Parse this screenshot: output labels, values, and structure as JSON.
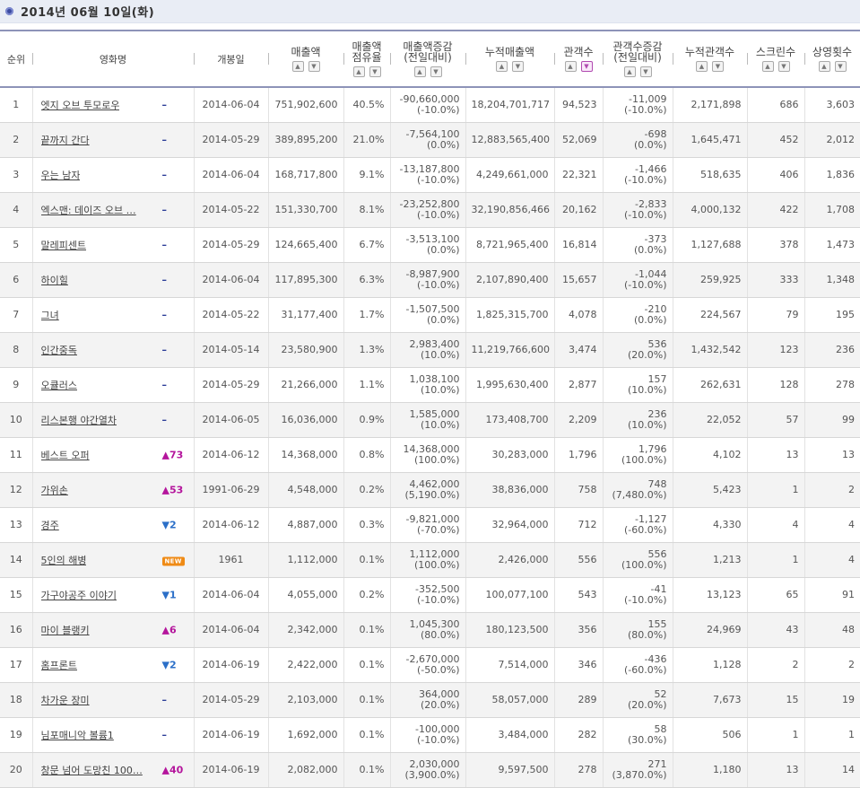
{
  "header": {
    "title": "2014년 06월 10일(화)"
  },
  "columns": {
    "rank": "순위",
    "title": "영화명",
    "open_date": "개봉일",
    "sales": "매출액",
    "share_1": "매출액",
    "share_2": "점유율",
    "sales_change_1": "매출액증감",
    "sales_change_2": "(전일대비)",
    "cum_sales": "누적매출액",
    "audience": "관객수",
    "aud_change_1": "관객수증감",
    "aud_change_2": "(전일대비)",
    "cum_audience": "누적관객수",
    "screens": "스크린수",
    "showings": "상영횟수"
  },
  "rows": [
    {
      "rank": "1",
      "title": "엣지 오브 투모로우",
      "change": "–",
      "change_type": "same",
      "open": "2014-06-04",
      "sales": "751,902,600",
      "share": "40.5%",
      "sales_chg": "-90,660,000",
      "sales_chg_pct": "(-10.0%)",
      "cum_sales": "18,204,701,717",
      "aud": "94,523",
      "aud_chg": "-11,009",
      "aud_chg_pct": "(-10.0%)",
      "cum_aud": "2,171,898",
      "screens": "686",
      "shows": "3,603"
    },
    {
      "rank": "2",
      "title": "끝까지 간다",
      "change": "–",
      "change_type": "same",
      "open": "2014-05-29",
      "sales": "389,895,200",
      "share": "21.0%",
      "sales_chg": "-7,564,100",
      "sales_chg_pct": "(0.0%)",
      "cum_sales": "12,883,565,400",
      "aud": "52,069",
      "aud_chg": "-698",
      "aud_chg_pct": "(0.0%)",
      "cum_aud": "1,645,471",
      "screens": "452",
      "shows": "2,012"
    },
    {
      "rank": "3",
      "title": "우는 남자",
      "change": "–",
      "change_type": "same",
      "open": "2014-06-04",
      "sales": "168,717,800",
      "share": "9.1%",
      "sales_chg": "-13,187,800",
      "sales_chg_pct": "(-10.0%)",
      "cum_sales": "4,249,661,000",
      "aud": "22,321",
      "aud_chg": "-1,466",
      "aud_chg_pct": "(-10.0%)",
      "cum_aud": "518,635",
      "screens": "406",
      "shows": "1,836"
    },
    {
      "rank": "4",
      "title": "엑스맨: 데이즈 오브 …",
      "change": "–",
      "change_type": "same",
      "open": "2014-05-22",
      "sales": "151,330,700",
      "share": "8.1%",
      "sales_chg": "-23,252,800",
      "sales_chg_pct": "(-10.0%)",
      "cum_sales": "32,190,856,466",
      "aud": "20,162",
      "aud_chg": "-2,833",
      "aud_chg_pct": "(-10.0%)",
      "cum_aud": "4,000,132",
      "screens": "422",
      "shows": "1,708"
    },
    {
      "rank": "5",
      "title": "말레피센트",
      "change": "–",
      "change_type": "same",
      "open": "2014-05-29",
      "sales": "124,665,400",
      "share": "6.7%",
      "sales_chg": "-3,513,100",
      "sales_chg_pct": "(0.0%)",
      "cum_sales": "8,721,965,400",
      "aud": "16,814",
      "aud_chg": "-373",
      "aud_chg_pct": "(0.0%)",
      "cum_aud": "1,127,688",
      "screens": "378",
      "shows": "1,473"
    },
    {
      "rank": "6",
      "title": "하이힐",
      "change": "–",
      "change_type": "same",
      "open": "2014-06-04",
      "sales": "117,895,300",
      "share": "6.3%",
      "sales_chg": "-8,987,900",
      "sales_chg_pct": "(-10.0%)",
      "cum_sales": "2,107,890,400",
      "aud": "15,657",
      "aud_chg": "-1,044",
      "aud_chg_pct": "(-10.0%)",
      "cum_aud": "259,925",
      "screens": "333",
      "shows": "1,348"
    },
    {
      "rank": "7",
      "title": "그녀",
      "change": "–",
      "change_type": "same",
      "open": "2014-05-22",
      "sales": "31,177,400",
      "share": "1.7%",
      "sales_chg": "-1,507,500",
      "sales_chg_pct": "(0.0%)",
      "cum_sales": "1,825,315,700",
      "aud": "4,078",
      "aud_chg": "-210",
      "aud_chg_pct": "(0.0%)",
      "cum_aud": "224,567",
      "screens": "79",
      "shows": "195"
    },
    {
      "rank": "8",
      "title": "인간중독",
      "change": "–",
      "change_type": "same",
      "open": "2014-05-14",
      "sales": "23,580,900",
      "share": "1.3%",
      "sales_chg": "2,983,400",
      "sales_chg_pct": "(10.0%)",
      "cum_sales": "11,219,766,600",
      "aud": "3,474",
      "aud_chg": "536",
      "aud_chg_pct": "(20.0%)",
      "cum_aud": "1,432,542",
      "screens": "123",
      "shows": "236"
    },
    {
      "rank": "9",
      "title": "오큘러스",
      "change": "–",
      "change_type": "same",
      "open": "2014-05-29",
      "sales": "21,266,000",
      "share": "1.1%",
      "sales_chg": "1,038,100",
      "sales_chg_pct": "(10.0%)",
      "cum_sales": "1,995,630,400",
      "aud": "2,877",
      "aud_chg": "157",
      "aud_chg_pct": "(10.0%)",
      "cum_aud": "262,631",
      "screens": "128",
      "shows": "278"
    },
    {
      "rank": "10",
      "title": "리스본행 야간열차",
      "change": "–",
      "change_type": "same",
      "open": "2014-06-05",
      "sales": "16,036,000",
      "share": "0.9%",
      "sales_chg": "1,585,000",
      "sales_chg_pct": "(10.0%)",
      "cum_sales": "173,408,700",
      "aud": "2,209",
      "aud_chg": "236",
      "aud_chg_pct": "(10.0%)",
      "cum_aud": "22,052",
      "screens": "57",
      "shows": "99"
    },
    {
      "rank": "11",
      "title": "베스트 오퍼",
      "change": "▲73",
      "change_type": "up",
      "open": "2014-06-12",
      "sales": "14,368,000",
      "share": "0.8%",
      "sales_chg": "14,368,000",
      "sales_chg_pct": "(100.0%)",
      "cum_sales": "30,283,000",
      "aud": "1,796",
      "aud_chg": "1,796",
      "aud_chg_pct": "(100.0%)",
      "cum_aud": "4,102",
      "screens": "13",
      "shows": "13"
    },
    {
      "rank": "12",
      "title": "가위손",
      "change": "▲53",
      "change_type": "up",
      "open": "1991-06-29",
      "sales": "4,548,000",
      "share": "0.2%",
      "sales_chg": "4,462,000",
      "sales_chg_pct": "(5,190.0%)",
      "cum_sales": "38,836,000",
      "aud": "758",
      "aud_chg": "748",
      "aud_chg_pct": "(7,480.0%)",
      "cum_aud": "5,423",
      "screens": "1",
      "shows": "2"
    },
    {
      "rank": "13",
      "title": "경주",
      "change": "▼2",
      "change_type": "down",
      "open": "2014-06-12",
      "sales": "4,887,000",
      "share": "0.3%",
      "sales_chg": "-9,821,000",
      "sales_chg_pct": "(-70.0%)",
      "cum_sales": "32,964,000",
      "aud": "712",
      "aud_chg": "-1,127",
      "aud_chg_pct": "(-60.0%)",
      "cum_aud": "4,330",
      "screens": "4",
      "shows": "4"
    },
    {
      "rank": "14",
      "title": "5인의 해병",
      "change": "NEW",
      "change_type": "new",
      "open": "1961",
      "sales": "1,112,000",
      "share": "0.1%",
      "sales_chg": "1,112,000",
      "sales_chg_pct": "(100.0%)",
      "cum_sales": "2,426,000",
      "aud": "556",
      "aud_chg": "556",
      "aud_chg_pct": "(100.0%)",
      "cum_aud": "1,213",
      "screens": "1",
      "shows": "4"
    },
    {
      "rank": "15",
      "title": "가구야공주 이야기",
      "change": "▼1",
      "change_type": "down",
      "open": "2014-06-04",
      "sales": "4,055,000",
      "share": "0.2%",
      "sales_chg": "-352,500",
      "sales_chg_pct": "(-10.0%)",
      "cum_sales": "100,077,100",
      "aud": "543",
      "aud_chg": "-41",
      "aud_chg_pct": "(-10.0%)",
      "cum_aud": "13,123",
      "screens": "65",
      "shows": "91"
    },
    {
      "rank": "16",
      "title": "마이 블랭키",
      "change": "▲6",
      "change_type": "up",
      "open": "2014-06-04",
      "sales": "2,342,000",
      "share": "0.1%",
      "sales_chg": "1,045,300",
      "sales_chg_pct": "(80.0%)",
      "cum_sales": "180,123,500",
      "aud": "356",
      "aud_chg": "155",
      "aud_chg_pct": "(80.0%)",
      "cum_aud": "24,969",
      "screens": "43",
      "shows": "48"
    },
    {
      "rank": "17",
      "title": "홈프론트",
      "change": "▼2",
      "change_type": "down",
      "open": "2014-06-19",
      "sales": "2,422,000",
      "share": "0.1%",
      "sales_chg": "-2,670,000",
      "sales_chg_pct": "(-50.0%)",
      "cum_sales": "7,514,000",
      "aud": "346",
      "aud_chg": "-436",
      "aud_chg_pct": "(-60.0%)",
      "cum_aud": "1,128",
      "screens": "2",
      "shows": "2"
    },
    {
      "rank": "18",
      "title": "차가운 장미",
      "change": "–",
      "change_type": "same",
      "open": "2014-05-29",
      "sales": "2,103,000",
      "share": "0.1%",
      "sales_chg": "364,000",
      "sales_chg_pct": "(20.0%)",
      "cum_sales": "58,057,000",
      "aud": "289",
      "aud_chg": "52",
      "aud_chg_pct": "(20.0%)",
      "cum_aud": "7,673",
      "screens": "15",
      "shows": "19"
    },
    {
      "rank": "19",
      "title": "님포매니악 볼륨1",
      "change": "–",
      "change_type": "same",
      "open": "2014-06-19",
      "sales": "1,692,000",
      "share": "0.1%",
      "sales_chg": "-100,000",
      "sales_chg_pct": "(-10.0%)",
      "cum_sales": "3,484,000",
      "aud": "282",
      "aud_chg": "58",
      "aud_chg_pct": "(30.0%)",
      "cum_aud": "506",
      "screens": "1",
      "shows": "1"
    },
    {
      "rank": "20",
      "title": "창문 넘어 도망친 100…",
      "change": "▲40",
      "change_type": "up",
      "open": "2014-06-19",
      "sales": "2,082,000",
      "share": "0.1%",
      "sales_chg": "2,030,000",
      "sales_chg_pct": "(3,900.0%)",
      "cum_sales": "9,597,500",
      "aud": "278",
      "aud_chg": "271",
      "aud_chg_pct": "(3,870.0%)",
      "cum_aud": "1,180",
      "screens": "13",
      "shows": "14"
    }
  ],
  "colors": {
    "header_border": "#8d93b8",
    "up": "#b4159c",
    "down": "#2b6fc8",
    "same": "#2a3c98",
    "new": "#ef8a14"
  }
}
